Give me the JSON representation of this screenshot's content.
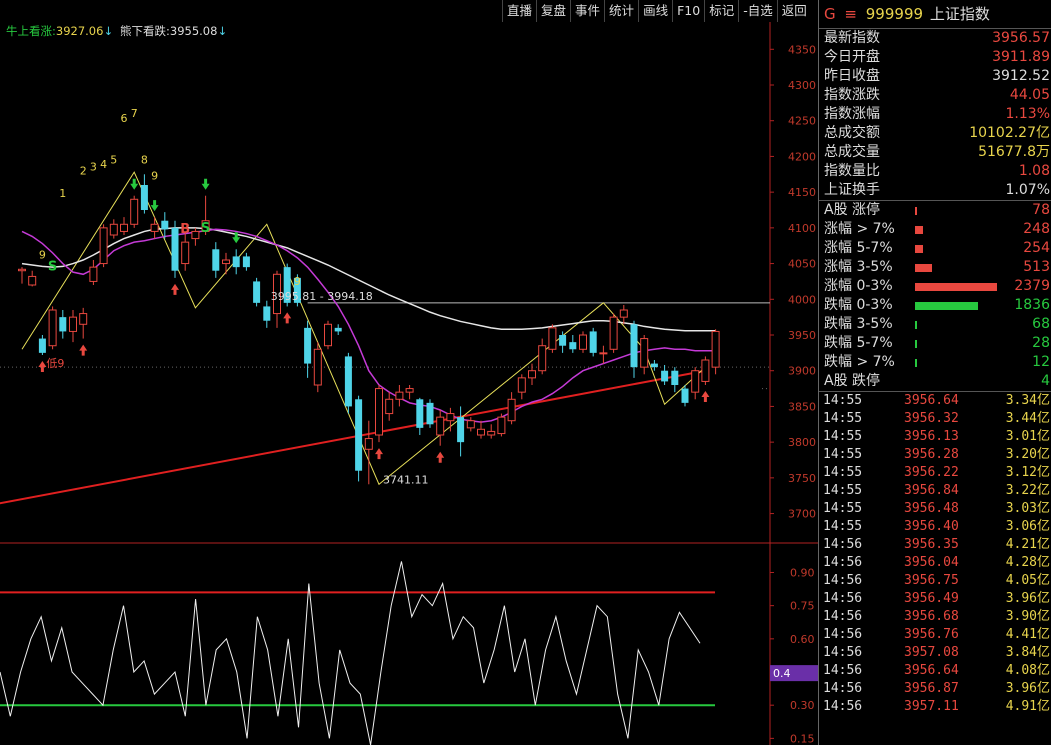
{
  "toolbar": [
    "直播",
    "复盘",
    "事件",
    "统计",
    "画线",
    "F10",
    "标记",
    "-自选",
    "返回"
  ],
  "indicators": {
    "bull_label": "牛上看涨:",
    "bull_value": "3927.06",
    "bear_label": "熊下看跌:",
    "bear_value": "3955.08",
    "arrow": "↓"
  },
  "colors": {
    "up": "#e8483f",
    "down": "#4fd4e8",
    "ma_white": "#e6e6e6",
    "ma_magenta": "#c43ad6",
    "trend": "#e02020",
    "zigzag": "#e8e05a",
    "green": "#27c93f",
    "yellow": "#e8d44d",
    "axis": "#b22222"
  },
  "chart_data": [
    {
      "type": "candlestick",
      "y_axis_ticks": [
        3700,
        3750,
        3800,
        3850,
        3900,
        3950,
        4000,
        4050,
        4100,
        4150,
        4200,
        4250,
        4300,
        4350
      ],
      "ylim": [
        3670,
        4370
      ],
      "candles": [
        {
          "o": 4040,
          "c": 4042,
          "h": 4045,
          "l": 4022
        },
        {
          "o": 4020,
          "c": 4032,
          "h": 4040,
          "l": 4018
        },
        {
          "o": 3945,
          "c": 3925,
          "h": 3950,
          "l": 3922
        },
        {
          "o": 3935,
          "c": 3985,
          "h": 3990,
          "l": 3930
        },
        {
          "o": 3975,
          "c": 3955,
          "h": 3985,
          "l": 3945
        },
        {
          "o": 3955,
          "c": 3975,
          "h": 3985,
          "l": 3940
        },
        {
          "o": 3965,
          "c": 3980,
          "h": 3988,
          "l": 3945
        },
        {
          "o": 4025,
          "c": 4045,
          "h": 4055,
          "l": 4020
        },
        {
          "o": 4050,
          "c": 4100,
          "h": 4105,
          "l": 4045
        },
        {
          "o": 4090,
          "c": 4105,
          "h": 4112,
          "l": 4085
        },
        {
          "o": 4095,
          "c": 4105,
          "h": 4115,
          "l": 4090
        },
        {
          "o": 4105,
          "c": 4140,
          "h": 4145,
          "l": 4100
        },
        {
          "o": 4160,
          "c": 4125,
          "h": 4175,
          "l": 4120
        },
        {
          "o": 4095,
          "c": 4105,
          "h": 4115,
          "l": 4085
        },
        {
          "o": 4110,
          "c": 4098,
          "h": 4122,
          "l": 4085
        },
        {
          "o": 4100,
          "c": 4040,
          "h": 4110,
          "l": 4030
        },
        {
          "o": 4050,
          "c": 4080,
          "h": 4095,
          "l": 4040
        },
        {
          "o": 4085,
          "c": 4095,
          "h": 4100,
          "l": 4075
        },
        {
          "o": 4095,
          "c": 4110,
          "h": 4145,
          "l": 4090
        },
        {
          "o": 4070,
          "c": 4040,
          "h": 4080,
          "l": 4030
        },
        {
          "o": 4050,
          "c": 4055,
          "h": 4065,
          "l": 4035
        },
        {
          "o": 4060,
          "c": 4045,
          "h": 4070,
          "l": 4035
        },
        {
          "o": 4060,
          "c": 4045,
          "h": 4065,
          "l": 4040
        },
        {
          "o": 4025,
          "c": 3995,
          "h": 4030,
          "l": 3990
        },
        {
          "o": 3990,
          "c": 3970,
          "h": 3998,
          "l": 3960
        },
        {
          "o": 3980,
          "c": 4035,
          "h": 4040,
          "l": 3960
        },
        {
          "o": 4045,
          "c": 3995,
          "h": 4050,
          "l": 3990
        },
        {
          "o": 4030,
          "c": 3995,
          "h": 4035,
          "l": 3990
        },
        {
          "o": 3960,
          "c": 3910,
          "h": 3970,
          "l": 3890
        },
        {
          "o": 3880,
          "c": 3930,
          "h": 3940,
          "l": 3870
        },
        {
          "o": 3935,
          "c": 3965,
          "h": 3970,
          "l": 3930
        },
        {
          "o": 3960,
          "c": 3955,
          "h": 3965,
          "l": 3950
        },
        {
          "o": 3920,
          "c": 3850,
          "h": 3925,
          "l": 3840
        },
        {
          "o": 3860,
          "c": 3760,
          "h": 3865,
          "l": 3745
        },
        {
          "o": 3790,
          "c": 3805,
          "h": 3830,
          "l": 3741
        },
        {
          "o": 3810,
          "c": 3875,
          "h": 3880,
          "l": 3800
        },
        {
          "o": 3840,
          "c": 3860,
          "h": 3870,
          "l": 3830
        },
        {
          "o": 3860,
          "c": 3870,
          "h": 3880,
          "l": 3850
        },
        {
          "o": 3870,
          "c": 3875,
          "h": 3880,
          "l": 3860
        },
        {
          "o": 3860,
          "c": 3820,
          "h": 3862,
          "l": 3810
        },
        {
          "o": 3855,
          "c": 3825,
          "h": 3860,
          "l": 3820
        },
        {
          "o": 3810,
          "c": 3835,
          "h": 3845,
          "l": 3795
        },
        {
          "o": 3830,
          "c": 3840,
          "h": 3848,
          "l": 3815
        },
        {
          "o": 3835,
          "c": 3800,
          "h": 3850,
          "l": 3780
        },
        {
          "o": 3820,
          "c": 3830,
          "h": 3835,
          "l": 3815
        },
        {
          "o": 3810,
          "c": 3818,
          "h": 3830,
          "l": 3805
        },
        {
          "o": 3810,
          "c": 3815,
          "h": 3825,
          "l": 3805
        },
        {
          "o": 3812,
          "c": 3835,
          "h": 3840,
          "l": 3808
        },
        {
          "o": 3830,
          "c": 3860,
          "h": 3870,
          "l": 3825
        },
        {
          "o": 3870,
          "c": 3890,
          "h": 3895,
          "l": 3860
        },
        {
          "o": 3890,
          "c": 3900,
          "h": 3910,
          "l": 3880
        },
        {
          "o": 3900,
          "c": 3935,
          "h": 3945,
          "l": 3895
        },
        {
          "o": 3930,
          "c": 3960,
          "h": 3965,
          "l": 3925
        },
        {
          "o": 3950,
          "c": 3935,
          "h": 3955,
          "l": 3925
        },
        {
          "o": 3940,
          "c": 3930,
          "h": 3950,
          "l": 3925
        },
        {
          "o": 3930,
          "c": 3950,
          "h": 3955,
          "l": 3925
        },
        {
          "o": 3955,
          "c": 3925,
          "h": 3960,
          "l": 3920
        },
        {
          "o": 3925,
          "c": 3925,
          "h": 3935,
          "l": 3910
        },
        {
          "o": 3930,
          "c": 3975,
          "h": 3980,
          "l": 3925
        },
        {
          "o": 3975,
          "c": 3985,
          "h": 3992,
          "l": 3965
        },
        {
          "o": 3965,
          "c": 3905,
          "h": 3970,
          "l": 3890
        },
        {
          "o": 3905,
          "c": 3945,
          "h": 3950,
          "l": 3895
        },
        {
          "o": 3910,
          "c": 3905,
          "h": 3915,
          "l": 3900
        },
        {
          "o": 3900,
          "c": 3885,
          "h": 3908,
          "l": 3880
        },
        {
          "o": 3900,
          "c": 3880,
          "h": 3905,
          "l": 3870
        },
        {
          "o": 3875,
          "c": 3855,
          "h": 3880,
          "l": 3850
        },
        {
          "o": 3870,
          "c": 3900,
          "h": 3905,
          "l": 3860
        },
        {
          "o": 3885,
          "c": 3915,
          "h": 3920,
          "l": 3880
        },
        {
          "o": 3905,
          "c": 3955,
          "h": 3958,
          "l": 3895
        }
      ],
      "ma_white": [
        4050,
        4048,
        4046,
        4045,
        4046,
        4050,
        4055,
        4062,
        4070,
        4078,
        4085,
        4090,
        4095,
        4098,
        4099,
        4100,
        4100,
        4100,
        4099,
        4097,
        4094,
        4091,
        4088,
        4084,
        4080,
        4076,
        4072,
        4066,
        4060,
        4054,
        4048,
        4041,
        4034,
        4027,
        4020,
        4013,
        4006,
        4000,
        3994,
        3988,
        3982,
        3977,
        3973,
        3969,
        3966,
        3963,
        3960,
        3958,
        3958,
        3958,
        3959,
        3960,
        3962,
        3964,
        3966,
        3968,
        3970,
        3970,
        3969,
        3967,
        3965,
        3962,
        3960,
        3958,
        3957,
        3956,
        3956,
        3956,
        3956
      ],
      "ma_magenta": [
        4095,
        4088,
        4078,
        4065,
        4050,
        4038,
        4035,
        4042,
        4055,
        4068,
        4075,
        4080,
        4082,
        4085,
        4088,
        4090,
        4092,
        4094,
        4096,
        4098,
        4097,
        4095,
        4092,
        4088,
        4082,
        4076,
        4068,
        4058,
        4045,
        4028,
        4010,
        3990,
        3965,
        3935,
        3900,
        3880,
        3870,
        3862,
        3855,
        3852,
        3850,
        3845,
        3838,
        3832,
        3830,
        3828,
        3830,
        3835,
        3842,
        3850,
        3856,
        3860,
        3868,
        3878,
        3890,
        3900,
        3905,
        3910,
        3915,
        3920,
        3925,
        3928,
        3930,
        3932,
        3930,
        3930,
        3928,
        3928,
        3928
      ],
      "trendline": [
        [
          -12,
          3688
        ],
        [
          67,
          3900
        ]
      ],
      "zigzag_line": [
        [
          0,
          3930
        ],
        [
          11,
          4178
        ],
        [
          17,
          3988
        ],
        [
          24,
          4105
        ],
        [
          35,
          3741
        ],
        [
          57,
          3995
        ],
        [
          61,
          3930
        ],
        [
          63,
          3853
        ],
        [
          67,
          3905
        ]
      ],
      "hline": 3995,
      "annotations": [
        {
          "text": "3995.81 - 3994.18",
          "i": 24,
          "price": 3999
        },
        {
          "text": "3741.11",
          "i": 35,
          "price": 3742
        },
        {
          "text": "低9",
          "i": 2,
          "price": 3905
        }
      ],
      "counts": [
        {
          "t": "1",
          "i": 4,
          "price": 4143
        },
        {
          "t": "2",
          "i": 6,
          "price": 4175
        },
        {
          "t": "3",
          "i": 7,
          "price": 4180
        },
        {
          "t": "4",
          "i": 8,
          "price": 4184
        },
        {
          "t": "5",
          "i": 9,
          "price": 4190
        },
        {
          "t": "6",
          "i": 10,
          "price": 4248
        },
        {
          "t": "7",
          "i": 11,
          "price": 4255
        },
        {
          "t": "8",
          "i": 12,
          "price": 4190
        },
        {
          "t": "9",
          "i": 13,
          "price": 4168
        },
        {
          "t": "9",
          "i": 2,
          "price": 4057
        },
        {
          "t": "9",
          "i": 27,
          "price": 4020
        }
      ],
      "signals": [
        {
          "t": "S",
          "i": 3,
          "price": 4040,
          "color": "#27c93f"
        },
        {
          "t": "B",
          "i": 16,
          "price": 4093,
          "color": "#e8483f"
        },
        {
          "t": "S",
          "i": 18,
          "price": 4094,
          "color": "#27c93f"
        }
      ],
      "arrows_up": [
        2,
        6,
        15,
        26,
        35,
        41,
        67
      ],
      "arrows_down": [
        11,
        13,
        18,
        21
      ]
    },
    {
      "type": "line",
      "y_axis_ticks": [
        0.15,
        0.3,
        0.45,
        0.6,
        0.75,
        0.9
      ],
      "ylim": [
        0.12,
        0.97
      ],
      "hline_red": 0.81,
      "hline_green": 0.3,
      "current_label": "0.4",
      "values": [
        0.45,
        0.25,
        0.45,
        0.6,
        0.7,
        0.5,
        0.65,
        0.45,
        0.4,
        0.35,
        0.3,
        0.55,
        0.75,
        0.45,
        0.5,
        0.35,
        0.4,
        0.45,
        0.25,
        0.78,
        0.3,
        0.55,
        0.6,
        0.45,
        0.15,
        0.7,
        0.55,
        0.25,
        0.6,
        0.2,
        0.85,
        0.4,
        0.15,
        0.55,
        0.4,
        0.35,
        0.12,
        0.45,
        0.75,
        0.95,
        0.7,
        0.8,
        0.75,
        0.85,
        0.6,
        0.7,
        0.65,
        0.4,
        0.55,
        0.75,
        0.45,
        0.6,
        0.3,
        0.55,
        0.7,
        0.5,
        0.35,
        0.55,
        0.75,
        0.7,
        0.35,
        0.15,
        0.55,
        0.45,
        0.3,
        0.6,
        0.72,
        0.65,
        0.58
      ]
    }
  ],
  "panel": {
    "symbol_g": "G",
    "symbol_menu": "≡",
    "code": "999999",
    "name": "上证指数",
    "stats": [
      {
        "label": "最新指数",
        "value": "3956.57",
        "color": "#e8483f"
      },
      {
        "label": "今日开盘",
        "value": "3911.89",
        "color": "#e8483f"
      },
      {
        "label": "昨日收盘",
        "value": "3912.52",
        "color": "#dddddd"
      },
      {
        "label": "指数涨跌",
        "value": "44.05",
        "color": "#e8483f"
      },
      {
        "label": "指数涨幅",
        "value": "1.13%",
        "color": "#e8483f"
      },
      {
        "label": "总成交额",
        "value": "10102.27亿",
        "color": "#e8d44d"
      },
      {
        "label": "总成交量",
        "value": "51677.8万",
        "color": "#e8d44d"
      },
      {
        "label": "指数量比",
        "value": "1.08",
        "color": "#e8483f"
      },
      {
        "label": "上证换手",
        "value": "1.07%",
        "color": "#dddddd"
      }
    ],
    "breadth": [
      {
        "label": "A股 涨停",
        "value": "78",
        "color": "#e8483f",
        "bar": 2
      },
      {
        "label": "涨幅 > 7%",
        "value": "248",
        "color": "#e8483f",
        "bar": 8
      },
      {
        "label": "涨幅 5-7%",
        "value": "254",
        "color": "#e8483f",
        "bar": 8
      },
      {
        "label": "涨幅 3-5%",
        "value": "513",
        "color": "#e8483f",
        "bar": 17
      },
      {
        "label": "涨幅 0-3%",
        "value": "2379",
        "color": "#e8483f",
        "bar": 82
      },
      {
        "label": "跌幅 0-3%",
        "value": "1836",
        "color": "#27c93f",
        "bar": 63
      },
      {
        "label": "跌幅 3-5%",
        "value": "68",
        "color": "#27c93f",
        "bar": 2
      },
      {
        "label": "跌幅 5-7%",
        "value": "28",
        "color": "#27c93f",
        "bar": 1
      },
      {
        "label": "跌幅 > 7%",
        "value": "12",
        "color": "#27c93f",
        "bar": 1
      },
      {
        "label": "A股 跌停",
        "value": "4",
        "color": "#27c93f",
        "bar": 0
      }
    ],
    "ticks": [
      {
        "time": "14:55",
        "price": "3956.64",
        "vol": "3.34亿"
      },
      {
        "time": "14:55",
        "price": "3956.32",
        "vol": "3.44亿"
      },
      {
        "time": "14:55",
        "price": "3956.13",
        "vol": "3.01亿"
      },
      {
        "time": "14:55",
        "price": "3956.28",
        "vol": "3.20亿"
      },
      {
        "time": "14:55",
        "price": "3956.22",
        "vol": "3.12亿"
      },
      {
        "time": "14:55",
        "price": "3956.84",
        "vol": "3.22亿"
      },
      {
        "time": "14:55",
        "price": "3956.48",
        "vol": "3.03亿"
      },
      {
        "time": "14:55",
        "price": "3956.40",
        "vol": "3.06亿"
      },
      {
        "time": "14:56",
        "price": "3956.35",
        "vol": "4.21亿"
      },
      {
        "time": "14:56",
        "price": "3956.04",
        "vol": "4.28亿"
      },
      {
        "time": "14:56",
        "price": "3956.75",
        "vol": "4.05亿"
      },
      {
        "time": "14:56",
        "price": "3956.49",
        "vol": "3.96亿"
      },
      {
        "time": "14:56",
        "price": "3956.68",
        "vol": "3.90亿"
      },
      {
        "time": "14:56",
        "price": "3956.76",
        "vol": "4.41亿"
      },
      {
        "time": "14:56",
        "price": "3957.08",
        "vol": "3.84亿"
      },
      {
        "time": "14:56",
        "price": "3956.64",
        "vol": "4.08亿"
      },
      {
        "time": "14:56",
        "price": "3956.87",
        "vol": "3.96亿"
      },
      {
        "time": "14:56",
        "price": "3957.11",
        "vol": "4.91亿"
      }
    ]
  }
}
